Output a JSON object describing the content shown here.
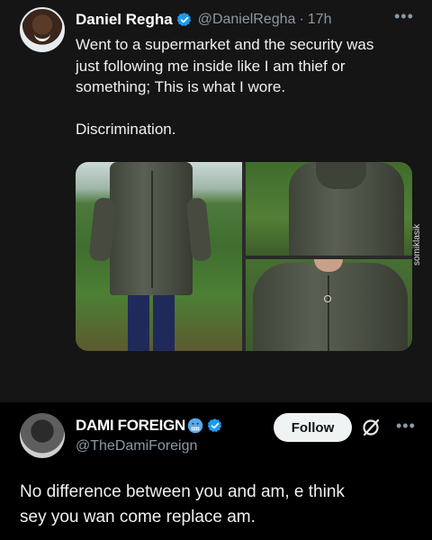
{
  "tweet1": {
    "author_name": "Daniel Regha",
    "handle": "@DanielRegha",
    "separator": "·",
    "time": "17h",
    "more": "•••",
    "lines": [
      "Went to a supermarket and the security was",
      "just following me inside like I am thief or",
      "something; This is what I wore."
    ],
    "line2": "Discrimination.",
    "watermark": "somiklasik"
  },
  "tweet2": {
    "author_name": "DAMI FOREIGN",
    "handle": "@TheDamiForeign",
    "follow_label": "Follow",
    "more": "•••",
    "lines": [
      "No difference between you and am, e think",
      "sey you wan come replace am."
    ]
  },
  "colors": {
    "verified": "#1d9bf0",
    "muted": "#8b98a5",
    "follow_bg": "#eff3f4"
  },
  "icons": {
    "verified": "verified-badge-icon",
    "emoji": "cold-face-emoji-icon",
    "grok": "grok-icon",
    "more": "more-icon"
  }
}
